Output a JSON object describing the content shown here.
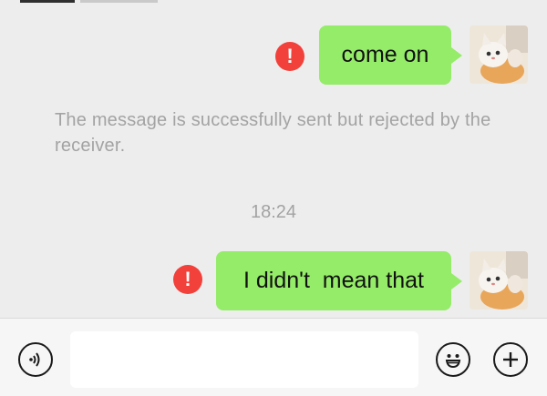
{
  "messages": [
    {
      "text": "come on",
      "status": "error",
      "status_symbol": "!"
    },
    {
      "text": "I didn't  mean that",
      "status": "error",
      "status_symbol": "!"
    }
  ],
  "system_notice": "The message is successfully sent but rejected by the receiver.",
  "timestamp": "18:24",
  "input": {
    "value": "",
    "placeholder": ""
  },
  "icons": {
    "voice": "voice-icon",
    "emoji": "emoji-icon",
    "more": "plus-icon",
    "error": "error-icon"
  },
  "colors": {
    "bubble": "#95ec69",
    "error": "#f2403b",
    "background": "#ededed",
    "system_text": "#a3a3a3"
  }
}
